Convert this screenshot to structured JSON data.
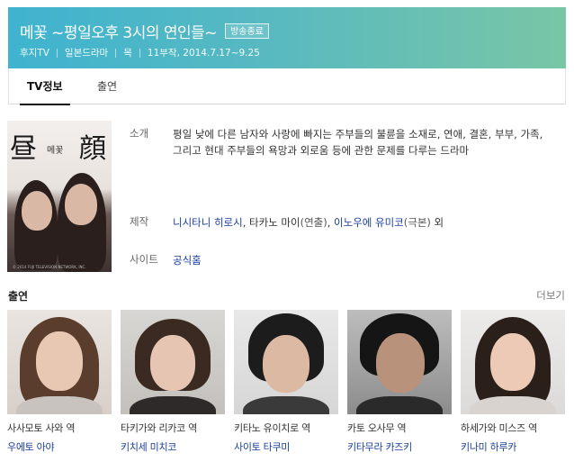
{
  "header": {
    "title": "메꽃 ~평일오후 3시의 연인들~",
    "badge": "방송종료",
    "meta": [
      "후지TV",
      "일본드라마",
      "목",
      "11부작, 2014.7.17~9.25"
    ],
    "colors": {
      "gradient_start": "#3fb3cf",
      "gradient_end": "#79c6a6"
    }
  },
  "tabs": [
    {
      "label": "TV정보",
      "active": true
    },
    {
      "label": "출연",
      "active": false
    }
  ],
  "poster": {
    "title_kanji_1": "昼",
    "title_kanji_2": "顔",
    "title_small": "메꽃",
    "copyright": "© 2014 FUJI TELEVISION NETWORK, INC."
  },
  "info": {
    "intro_label": "소개",
    "intro_text": "평일 낮에 다른 남자와 사랑에 빠지는 주부들의 불륜을 소재로, 연애, 결혼, 부부, 가족, 그리고 현대 주부들의 욕망과 외로움 등에 관한 문제를 다루는 드라마",
    "production_label": "제작",
    "production": {
      "p1": "니시타니 히로시",
      "sep1": ", ",
      "p2": "타카노 마이",
      "p2_role": "(연출)",
      "sep2": ", ",
      "p3": "이노우에 유미코",
      "p3_role": "(극본)",
      "tail": " 외"
    },
    "site_label": "사이트",
    "site_link": "공식홈"
  },
  "cast": {
    "title": "출연",
    "more": "더보기",
    "items": [
      {
        "role": "사사모토 사와 역",
        "actor": "우에토 아야"
      },
      {
        "role": "타키가와 리카코 역",
        "actor": "키치세 미치코"
      },
      {
        "role": "키타노 유이치로 역",
        "actor": "사이토 타쿠미"
      },
      {
        "role": "카토 오사무 역",
        "actor": "키타무라 카즈키"
      },
      {
        "role": "하세가와 미스즈 역",
        "actor": "키나미 하루카"
      }
    ]
  }
}
